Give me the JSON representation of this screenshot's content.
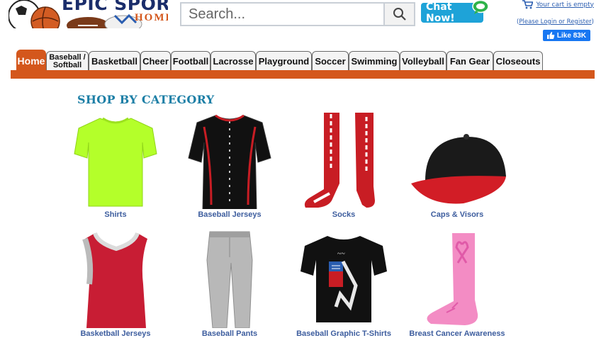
{
  "header": {
    "logo_text": "EPIC SPORTS",
    "logo_sub": "HOME",
    "search_placeholder": "Search...",
    "chat_label": "Chat Now!",
    "cart_text": "Your cart is empty",
    "login_prefix": "(",
    "login_text": "Please Login or Register",
    "login_suffix": ")",
    "like_label": "Like 83K"
  },
  "nav": {
    "tabs": [
      {
        "label": "Home",
        "active": true
      },
      {
        "label": "Baseball / Softball"
      },
      {
        "label": "Basketball"
      },
      {
        "label": "Cheer"
      },
      {
        "label": "Football"
      },
      {
        "label": "Lacrosse"
      },
      {
        "label": "Playground"
      },
      {
        "label": "Soccer"
      },
      {
        "label": "Swimming"
      },
      {
        "label": "Volleyball"
      },
      {
        "label": "Fan Gear"
      },
      {
        "label": "Closeouts"
      }
    ]
  },
  "main": {
    "section_title": "SHOP BY CATEGORY",
    "categories": [
      {
        "label": "Shirts",
        "icon": "shirt-icon",
        "color": "#b4ff2a"
      },
      {
        "label": "Baseball Jerseys",
        "icon": "baseball-jersey-icon",
        "color": "#111111"
      },
      {
        "label": "Socks",
        "icon": "socks-icon",
        "color": "#c81d24"
      },
      {
        "label": "Caps & Visors",
        "icon": "cap-icon",
        "color": "#1a1a1a"
      },
      {
        "label": "Basketball Jerseys",
        "icon": "basketball-jersey-icon",
        "color": "#c81d34"
      },
      {
        "label": "Baseball Pants",
        "icon": "pants-icon",
        "color": "#b8b8b8"
      },
      {
        "label": "Baseball Graphic T-Shirts",
        "icon": "graphic-tshirt-icon",
        "color": "#111111"
      },
      {
        "label": "Breast Cancer Awareness",
        "icon": "pink-sock-icon",
        "color": "#f38cc4"
      }
    ]
  }
}
